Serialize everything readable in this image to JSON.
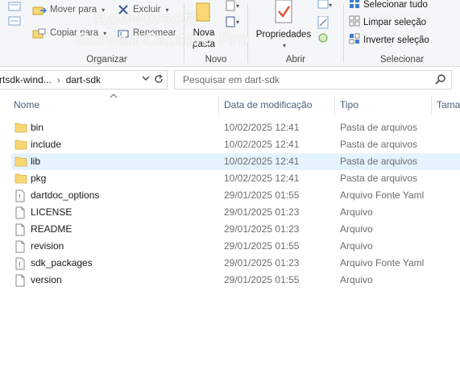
{
  "ribbon": {
    "organize": {
      "move_to": "Mover para",
      "copy_to": "Copiar para",
      "delete": "Excluir",
      "rename": "Renomear",
      "label": "Organizar"
    },
    "new": {
      "new_folder_line1": "Nova",
      "new_folder_line2": "pasta",
      "label": "Novo"
    },
    "open": {
      "properties": "Propriedades",
      "label": "Abrir"
    },
    "select": {
      "select_all": "Selecionar tudo",
      "select_none": "Limpar seleção",
      "invert": "Inverter seleção",
      "label": "Selecionar"
    }
  },
  "watermark": {
    "line1": "Apowersoft",
    "line2": "Screen Capture Pro"
  },
  "address": {
    "crumb1": "rtsdk-wind...",
    "crumb2": "dart-sdk"
  },
  "search": {
    "placeholder": "Pesquisar em dart-sdk"
  },
  "columns": {
    "name": "Nome",
    "modified": "Data de modificação",
    "type": "Tipo",
    "size": "Tama"
  },
  "files": [
    {
      "name": "bin",
      "modified": "10/02/2025 12:41",
      "type": "Pasta de arquivos",
      "icon": "folder-icon"
    },
    {
      "name": "include",
      "modified": "10/02/2025 12:41",
      "type": "Pasta de arquivos",
      "icon": "folder-icon"
    },
    {
      "name": "lib",
      "modified": "10/02/2025 12:41",
      "type": "Pasta de arquivos",
      "icon": "folder-icon"
    },
    {
      "name": "pkg",
      "modified": "10/02/2025 12:41",
      "type": "Pasta de arquivos",
      "icon": "folder-icon"
    },
    {
      "name": "dartdoc_options",
      "modified": "29/01/2025 01:55",
      "type": "Arquivo Fonte Yaml",
      "icon": "yaml-file-icon"
    },
    {
      "name": "LICENSE",
      "modified": "29/01/2025 01:23",
      "type": "Arquivo",
      "icon": "file-icon"
    },
    {
      "name": "README",
      "modified": "29/01/2025 01:23",
      "type": "Arquivo",
      "icon": "file-icon"
    },
    {
      "name": "revision",
      "modified": "29/01/2025 01:55",
      "type": "Arquivo",
      "icon": "file-icon"
    },
    {
      "name": "sdk_packages",
      "modified": "29/01/2025 01:23",
      "type": "Arquivo Fonte Yaml",
      "icon": "yaml-file-icon"
    },
    {
      "name": "version",
      "modified": "29/01/2025 01:55",
      "type": "Arquivo",
      "icon": "file-icon"
    }
  ],
  "colors": {
    "folder": "#f8d775",
    "selected_row": "#e5f3ff",
    "header_text": "#4c607a",
    "properties_check": "#e0583a"
  }
}
